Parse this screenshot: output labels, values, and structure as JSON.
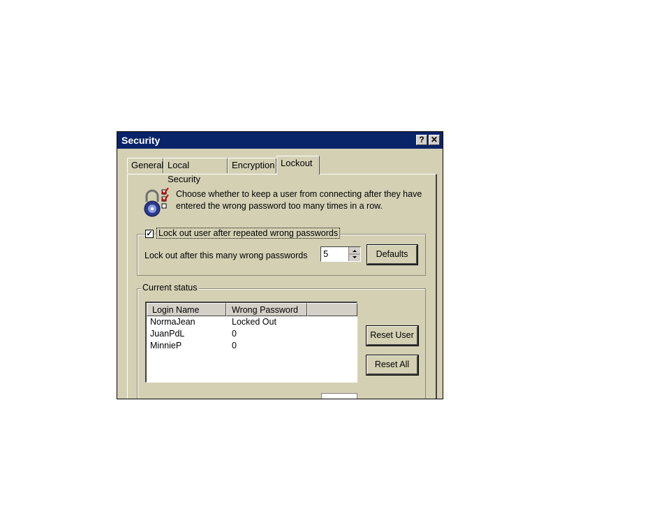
{
  "window": {
    "title": "Security",
    "help_label": "?",
    "close_label": "✕"
  },
  "tabs": [
    {
      "label": "General"
    },
    {
      "label": "Local Security"
    },
    {
      "label": "Encryption"
    },
    {
      "label": "Lockout",
      "active": true
    }
  ],
  "description": "Choose whether to keep a user from connecting after they have entered the wrong password too many times in a row.",
  "lockout_group": {
    "checkbox_label": "Lock out user after repeated wrong passwords",
    "checked": true,
    "threshold_label": "Lock out after this many wrong passwords",
    "threshold_value": "5",
    "defaults_button": "Defaults"
  },
  "status_group": {
    "legend": "Current status",
    "columns": [
      "Login Name",
      "Wrong Password"
    ],
    "rows": [
      {
        "login": "NormaJean",
        "wrong": "Locked Out"
      },
      {
        "login": "JuanPdL",
        "wrong": "0"
      },
      {
        "login": "MinnieP",
        "wrong": "0"
      }
    ],
    "reset_user_button": "Reset User",
    "reset_all_button": "Reset All"
  },
  "icons": {
    "lock": "padlock-icon",
    "checklist": "checklist-icon"
  },
  "colors": {
    "titlebar": "#0a246a",
    "dialog": "#d4d0b4",
    "check_red": "#cc0000"
  }
}
